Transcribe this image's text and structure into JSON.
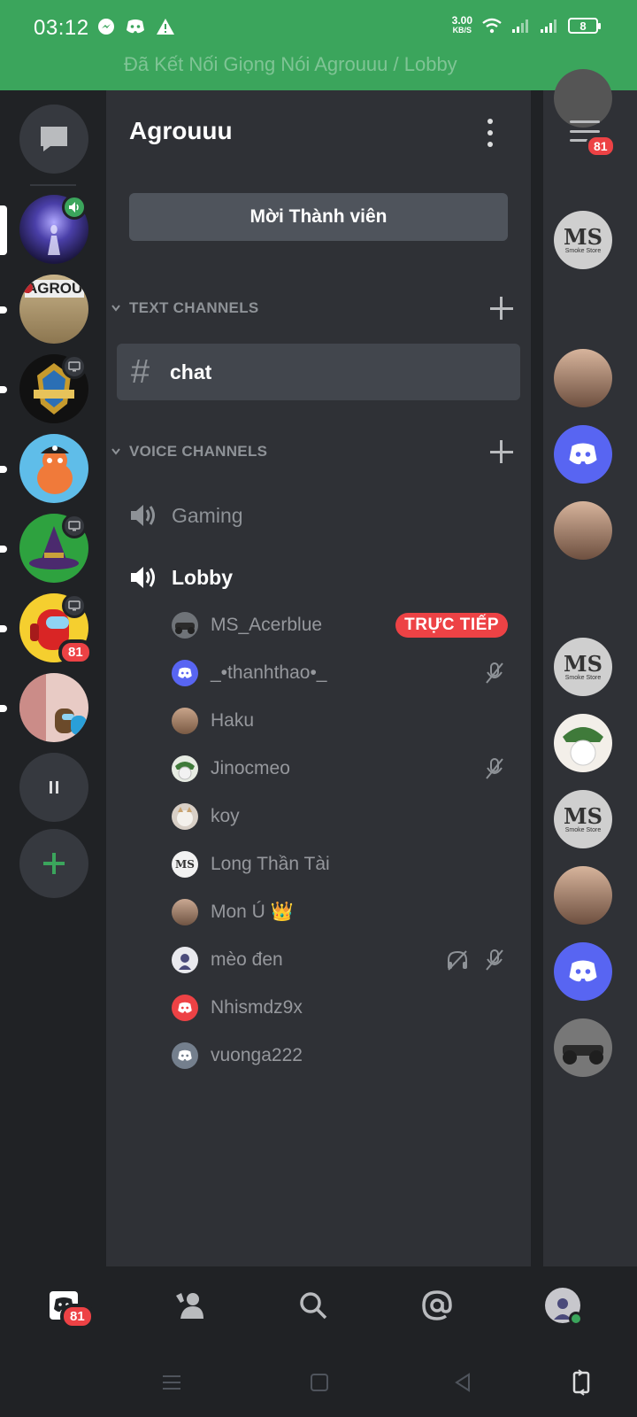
{
  "status_bar": {
    "time": "03:12",
    "speed_value": "3.00",
    "speed_unit": "KB/S",
    "battery": "8",
    "connection_text": "Đã Kết Nối Giọng Nói Agrouuu / Lobby"
  },
  "server_rail": {
    "servers": [
      {
        "name": "server-voice-active",
        "color": "#3b2f7a"
      },
      {
        "name": "server-agrou",
        "color": "#b49a6a",
        "text": "AGROU"
      },
      {
        "name": "server-challenger",
        "color": "#1a1a1a"
      },
      {
        "name": "server-pirate-dino",
        "color": "#59b7e8"
      },
      {
        "name": "server-witch-hat",
        "color": "#2e9e3f"
      },
      {
        "name": "server-among-us",
        "color": "#f6d02f",
        "badge": "81"
      },
      {
        "name": "server-among-us-2",
        "color": "#e9c8c4"
      }
    ]
  },
  "channel_panel": {
    "guild_name": "Agrouuu",
    "invite_label": "Mời Thành viên",
    "text_category": "TEXT CHANNELS",
    "text_channel": "chat",
    "voice_category": "VOICE CHANNELS",
    "voice_channels": [
      "Gaming",
      "Lobby"
    ],
    "lobby_members": [
      {
        "name": "MS_Acerblue",
        "avatar": "photo-bike",
        "live": "TRỰC TIẾP"
      },
      {
        "name": "_•thanhthao•_",
        "avatar": "discord-blurple",
        "muted": true
      },
      {
        "name": "Haku",
        "avatar": "photo-haku"
      },
      {
        "name": "Jinocmeo",
        "avatar": "photo-frog",
        "muted": true
      },
      {
        "name": "koy",
        "avatar": "photo-cat"
      },
      {
        "name": "Long Thần Tài",
        "avatar": "smoke-store"
      },
      {
        "name": "Mon Ú 👑",
        "avatar": "photo-boy"
      },
      {
        "name": "mèo đen",
        "avatar": "photo-meo",
        "muted": true,
        "deafened": true
      },
      {
        "name": "Nhismdz9x",
        "avatar": "discord-red"
      },
      {
        "name": "vuonga222",
        "avatar": "discord-grey"
      }
    ]
  },
  "member_rail": {
    "badge": "81",
    "smoke_brand": "MS",
    "smoke_sub": "Smoke Store"
  },
  "tab_bar": {
    "home_badge": "81"
  },
  "colors": {
    "status_green": "#3ba55c",
    "blurple": "#5865f2",
    "red": "#ed4245"
  }
}
